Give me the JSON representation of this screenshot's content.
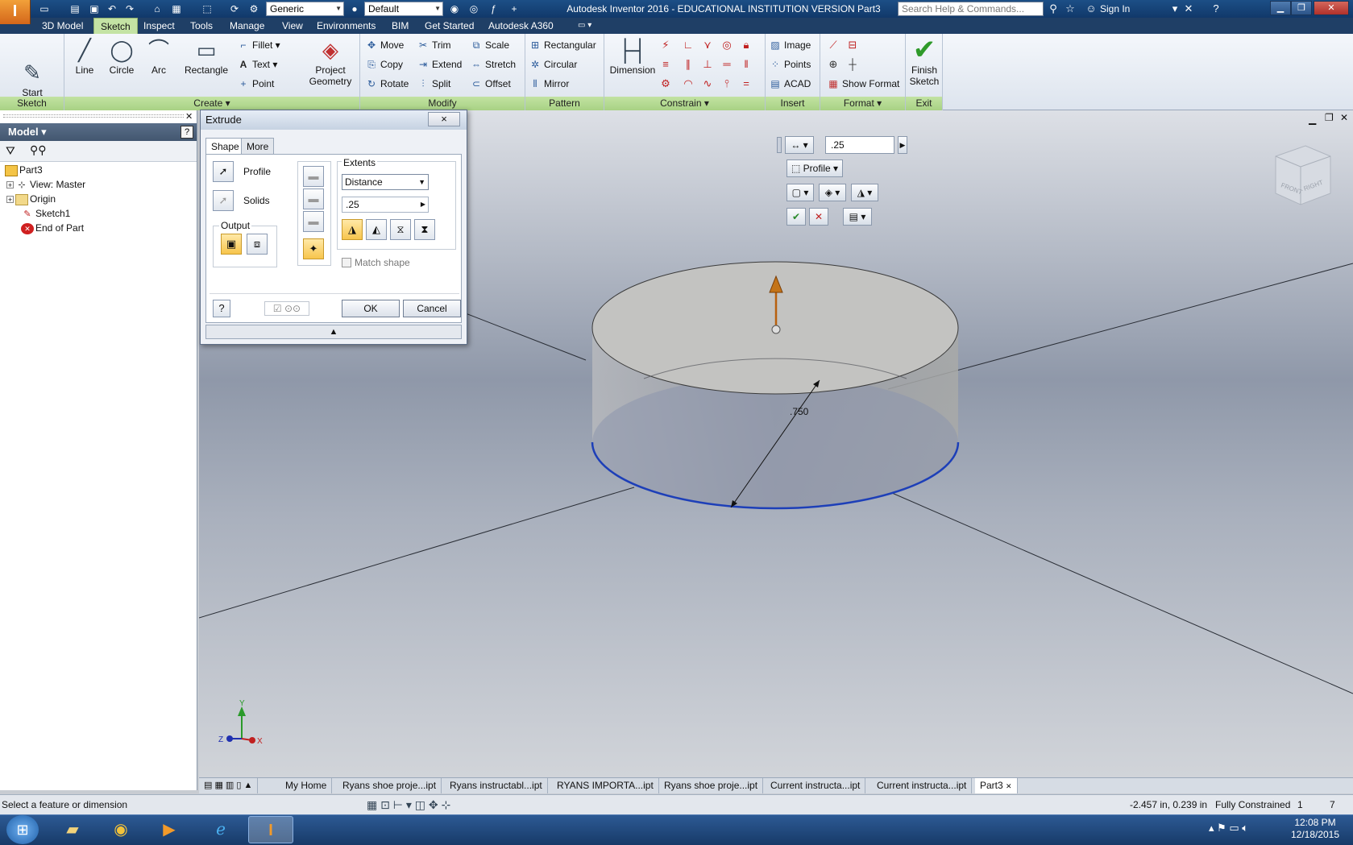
{
  "app": {
    "logo_letter": "I",
    "window_title": "Autodesk Inventor 2016 - EDUCATIONAL INSTITUTION VERSION    Part3",
    "material_combo": "Generic",
    "appearance_combo": "Default",
    "search_placeholder": "Search Help & Commands...",
    "sign_in": "Sign In"
  },
  "ribbon_tabs": [
    "3D Model",
    "Sketch",
    "Inspect",
    "Tools",
    "Manage",
    "View",
    "Environments",
    "BIM",
    "Get Started",
    "Autodesk A360"
  ],
  "ribbon": {
    "sketch_panel": {
      "title": "Sketch",
      "start": "Start\n2D Sketch"
    },
    "create_panel": {
      "title": "Create",
      "line": "Line",
      "circle": "Circle",
      "arc": "Arc",
      "rectangle": "Rectangle",
      "fillet": "Fillet",
      "text": "Text",
      "point": "Point",
      "project": "Project\nGeometry"
    },
    "modify_panel": {
      "title": "Modify",
      "move": "Move",
      "copy": "Copy",
      "rotate": "Rotate",
      "trim": "Trim",
      "extend": "Extend",
      "split": "Split",
      "scale": "Scale",
      "stretch": "Stretch",
      "offset": "Offset"
    },
    "pattern_panel": {
      "title": "Pattern",
      "rectangular": "Rectangular",
      "circular": "Circular",
      "mirror": "Mirror"
    },
    "constrain_panel": {
      "title": "Constrain",
      "dimension": "Dimension"
    },
    "insert_panel": {
      "title": "Insert",
      "image": "Image",
      "points": "Points",
      "acad": "ACAD"
    },
    "format_panel": {
      "title": "Format",
      "show_format": "Show Format"
    },
    "exit_panel": {
      "title": "Exit",
      "finish": "Finish\nSketch"
    }
  },
  "browser": {
    "title": "Model",
    "items": [
      "Part3",
      "View: Master",
      "Origin",
      "Sketch1",
      "End of Part"
    ]
  },
  "dialog": {
    "title": "Extrude",
    "close": "×",
    "tabs": [
      "Shape",
      "More"
    ],
    "profile_label": "Profile",
    "solids_label": "Solids",
    "output_label": "Output",
    "extents_label": "Extents",
    "extents_type": "Distance",
    "distance_value": ".25",
    "match_shape": "Match shape",
    "ok": "OK",
    "cancel": "Cancel"
  },
  "minitoolbar": {
    "distance_value": ".25",
    "profile": "Profile"
  },
  "viewport": {
    "dimension_label": ".750",
    "viewcube_front": "FRONT",
    "viewcube_right": "RIGHT"
  },
  "doc_tabs": [
    "My Home",
    "Ryans shoe proje...ipt",
    "Ryans instructabl...ipt",
    "RYANS IMPORTA...ipt",
    "Ryans shoe proje...ipt",
    "Current instructa...ipt",
    "Current instructa...ipt",
    "Part3"
  ],
  "status": {
    "message": "Select a feature or dimension",
    "coords": "-2.457 in, 0.239 in",
    "constraint": "Fully Constrained",
    "count1": "1",
    "count2": "7"
  },
  "taskbar": {
    "time": "12:08 PM",
    "date": "12/18/2015"
  },
  "colors": {
    "ribbon_accent": "#a8d184",
    "title_bar": "#1c4f86",
    "dialog_highlight": "#f7c54c",
    "sketch_profile": "#1d3fb8"
  }
}
